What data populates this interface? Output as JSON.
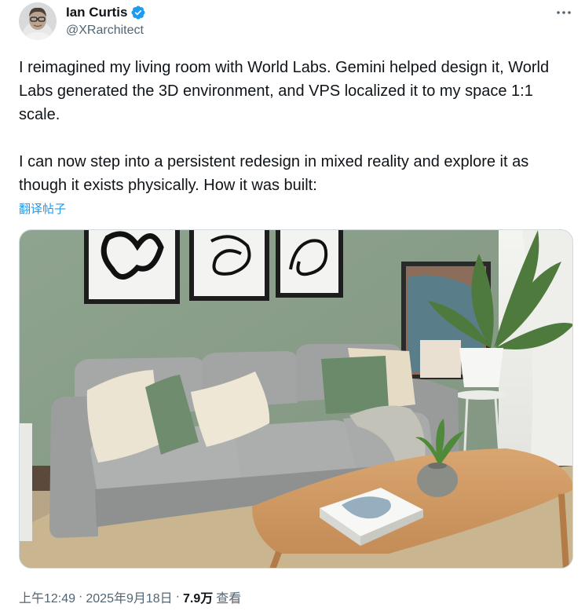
{
  "author": {
    "display_name": "Ian Curtis",
    "handle": "@XRarchitect",
    "verified_color": "#1d9bf0"
  },
  "tweet": {
    "paragraphs": [
      "I reimagined my living room with World Labs. Gemini helped design it, World Labs generated the 3D environment, and VPS localized it to my space 1:1 scale.",
      "I can now step into a persistent redesign in mixed reality and explore it as though it exists physically. How it was built:"
    ],
    "translate_label": "翻译帖子"
  },
  "meta": {
    "time": "上午12:49",
    "separator": "·",
    "date": "2025年9月18日",
    "views_count": "7.9万",
    "views_label": "查看"
  },
  "icons": {
    "verified": "verified-badge-icon",
    "more": "more-options-icon"
  }
}
